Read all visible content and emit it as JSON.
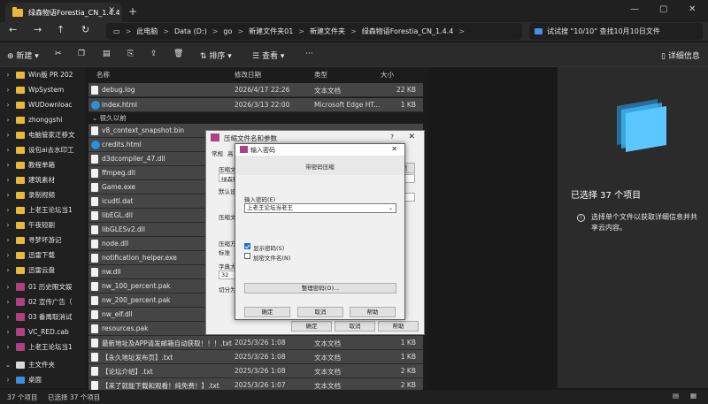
{
  "window": {
    "tab_title": "绿森物语Forestia_CN_1.4.4",
    "tab_close": "✕",
    "new_tab": "+",
    "minimize": "—",
    "maximize": "▢",
    "close": "✕"
  },
  "address": {
    "breadcrumbs": [
      "此电脑",
      "Data (D:)",
      "go",
      "新建文件夹01",
      "新建文件夹",
      "绿森物语Forestia_CN_1.4.4"
    ],
    "separator": ">",
    "search_text": "试试搜 \"10/10\" 查找10月10日文件"
  },
  "toolbar": {
    "new_label": "新建",
    "sort_label": "排序",
    "view_label": "查看",
    "more_label": "···",
    "details_label": "详细信息"
  },
  "sidebar": {
    "items": [
      {
        "label": "Win版 PR 202",
        "type": "folder"
      },
      {
        "label": "WpSystem",
        "type": "folder"
      },
      {
        "label": "WUDownloac",
        "type": "folder"
      },
      {
        "label": "zhonggshi",
        "type": "folder"
      },
      {
        "label": "电脑管家迁移文",
        "type": "folder"
      },
      {
        "label": "设包ai去水印工",
        "type": "folder"
      },
      {
        "label": "教程单箱",
        "type": "folder"
      },
      {
        "label": "建筑素材",
        "type": "folder"
      },
      {
        "label": "录制视频",
        "type": "folder"
      },
      {
        "label": "上老王论坛当1",
        "type": "folder"
      },
      {
        "label": "午夜短剧",
        "type": "folder"
      },
      {
        "label": "寻梦坏游记",
        "type": "folder"
      },
      {
        "label": "迅雷下载",
        "type": "folder"
      },
      {
        "label": "迅雷云盘",
        "type": "folder"
      },
      {
        "label": "01 历史眼文娱",
        "type": "archive"
      },
      {
        "label": "02 宣传广告（",
        "type": "archive"
      },
      {
        "label": "03 番禺取消试",
        "type": "archive"
      },
      {
        "label": "VC_RED.cab",
        "type": "archive"
      },
      {
        "label": "上老王论坛当1",
        "type": "archive"
      },
      {
        "label": "主文件夹",
        "type": "home"
      },
      {
        "label": "桌面",
        "type": "desktop"
      }
    ]
  },
  "columns": {
    "name": "名称",
    "date": "修改日期",
    "type": "类型",
    "size": "大小"
  },
  "group_label": "很久以前",
  "files": [
    {
      "name": "debug.log",
      "date": "2026/4/17 22:26",
      "type": "文本文档",
      "size": "22 KB",
      "icon": "file"
    },
    {
      "name": "index.html",
      "date": "2026/3/13 22:00",
      "type": "Microsoft Edge HT...",
      "size": "1 KB",
      "icon": "edge"
    },
    {
      "name": "v8_context_snapshot.bin",
      "date": "",
      "type": "",
      "size": "",
      "icon": "file"
    },
    {
      "name": "credits.html",
      "date": "",
      "type": "",
      "size": "",
      "icon": "edge"
    },
    {
      "name": "d3dcompiler_47.dll",
      "date": "",
      "type": "",
      "size": "",
      "icon": "file"
    },
    {
      "name": "ffmpeg.dll",
      "date": "",
      "type": "",
      "size": "",
      "icon": "file"
    },
    {
      "name": "Game.exe",
      "date": "",
      "type": "",
      "size": "",
      "icon": "file"
    },
    {
      "name": "icudtl.dat",
      "date": "",
      "type": "",
      "size": "",
      "icon": "file"
    },
    {
      "name": "libEGL.dll",
      "date": "",
      "type": "",
      "size": "",
      "icon": "file"
    },
    {
      "name": "libGLESv2.dll",
      "date": "",
      "type": "",
      "size": "",
      "icon": "file"
    },
    {
      "name": "node.dll",
      "date": "",
      "type": "",
      "size": "",
      "icon": "file"
    },
    {
      "name": "notification_helper.exe",
      "date": "",
      "type": "",
      "size": "",
      "icon": "file"
    },
    {
      "name": "nw.dll",
      "date": "",
      "type": "",
      "size": "",
      "icon": "file"
    },
    {
      "name": "nw_100_percent.pak",
      "date": "",
      "type": "",
      "size": "",
      "icon": "file"
    },
    {
      "name": "nw_200_percent.pak",
      "date": "",
      "type": "",
      "size": "",
      "icon": "file"
    },
    {
      "name": "nw_elf.dll",
      "date": "",
      "type": "",
      "size": "",
      "icon": "file"
    },
    {
      "name": "resources.pak",
      "date": "",
      "type": "",
      "size": "",
      "icon": "file"
    },
    {
      "name": "最新地址及APP请发邮箱自动获取！！！.txt",
      "date": "2025/3/26 1:08",
      "type": "文本文档",
      "size": "1 KB",
      "icon": "file"
    },
    {
      "name": "【永久地址发布页】.txt",
      "date": "2025/3/26 1:08",
      "type": "文本文档",
      "size": "1 KB",
      "icon": "file"
    },
    {
      "name": "【论坛介绍】.txt",
      "date": "2025/3/26 1:08",
      "type": "文本文档",
      "size": "2 KB",
      "icon": "file"
    },
    {
      "name": "【来了就能下载和观看！纯免费！】.txt",
      "date": "2025/3/26 1:07",
      "type": "文本文档",
      "size": "2 KB",
      "icon": "file"
    }
  ],
  "preview": {
    "selected_count": "已选择 37 个项目",
    "info": "选择单个文件以获取详细信息并共享云内容。"
  },
  "status": {
    "count": "37 个项目",
    "selected": "已选择 37 个项目"
  },
  "compress_dialog": {
    "title": "压缩文件名和参数",
    "tabs": [
      "常规",
      "高"
    ],
    "field_label_1": "压缩文",
    "field_value_1": "绿森物",
    "field_label_2": "默认设",
    "browse_button": "浏览(B)...",
    "label_compress_format": "压缩文",
    "label_method": "压缩方",
    "method_value": "标准",
    "label_dict": "字典大",
    "dict_value": "32",
    "label_split": "切分为",
    "ok_button": "确定",
    "cancel_button": "取消",
    "help_button": "帮助",
    "help_mark": "?",
    "close": "✕"
  },
  "password_dialog": {
    "title": "输入密码",
    "close": "✕",
    "mode_label": "带密码压缩",
    "input_label": "输入密码(E)",
    "input_value": "上老王论坛当老王",
    "show_password": "显示密码(S)",
    "encrypt_names": "加密文件名(N)",
    "organize_button": "整理密码(O)...",
    "ok": "确定",
    "cancel": "取消",
    "help": "帮助"
  }
}
